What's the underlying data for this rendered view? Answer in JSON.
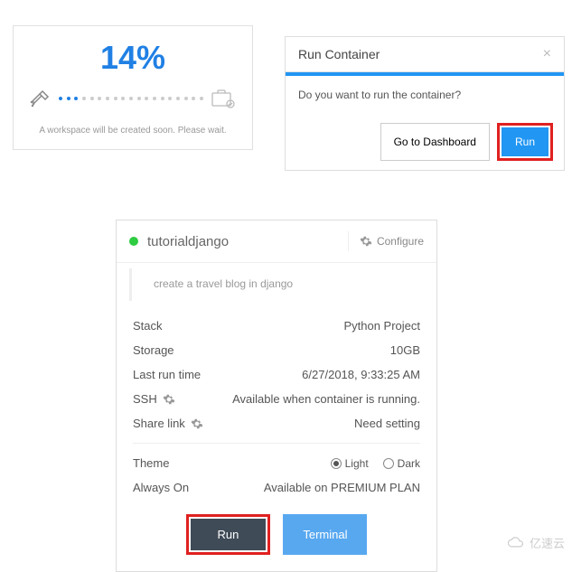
{
  "progress": {
    "pct": "14%",
    "note": "A workspace will be created soon. Please wait."
  },
  "dialog": {
    "title": "Run Container",
    "body": "Do you want to run the container?",
    "dashboard_btn": "Go to Dashboard",
    "run_btn": "Run"
  },
  "panel": {
    "title": "tutorialdjango",
    "configure": "Configure",
    "desc": "create a travel blog in django",
    "rows": {
      "stack_label": "Stack",
      "stack_value": "Python Project",
      "storage_label": "Storage",
      "storage_value": "10GB",
      "lastrun_label": "Last run time",
      "lastrun_value": "6/27/2018, 9:33:25 AM",
      "ssh_label": "SSH",
      "ssh_value": "Available when container is running.",
      "share_label": "Share link",
      "share_value": "Need setting",
      "theme_label": "Theme",
      "theme_light": "Light",
      "theme_dark": "Dark",
      "always_label": "Always On",
      "always_value": "Available on PREMIUM PLAN"
    },
    "run_btn": "Run",
    "terminal_btn": "Terminal"
  },
  "watermark": "亿速云"
}
